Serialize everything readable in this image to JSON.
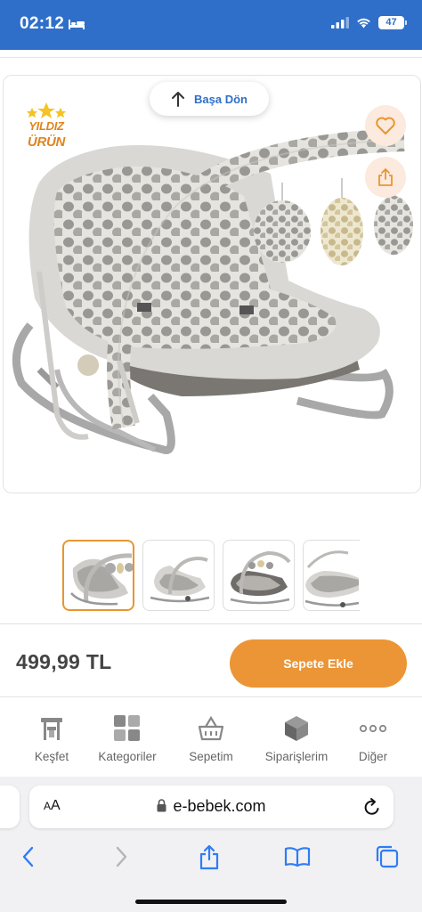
{
  "status": {
    "time": "02:12",
    "battery": "47"
  },
  "back_to_top": {
    "label": "Başa Dön"
  },
  "badge": {
    "line1": "YILDIZ",
    "line2": "ÜRÜN"
  },
  "product": {
    "price": "499,99 TL",
    "add_to_cart": "Sepete Ekle",
    "thumbnails": [
      "thumb-1",
      "thumb-2",
      "thumb-3",
      "thumb-4"
    ]
  },
  "tabs": [
    {
      "label": "Keşfet",
      "icon": "discover-icon"
    },
    {
      "label": "Kategoriler",
      "icon": "categories-icon"
    },
    {
      "label": "Sepetim",
      "icon": "cart-icon"
    },
    {
      "label": "Siparişlerim",
      "icon": "orders-icon"
    },
    {
      "label": "Diğer",
      "icon": "more-icon"
    }
  ],
  "browser": {
    "text_size": "AA",
    "url": "e-bebek.com"
  },
  "colors": {
    "brand_blue": "#2f6fc9",
    "accent_orange": "#ec9536"
  }
}
